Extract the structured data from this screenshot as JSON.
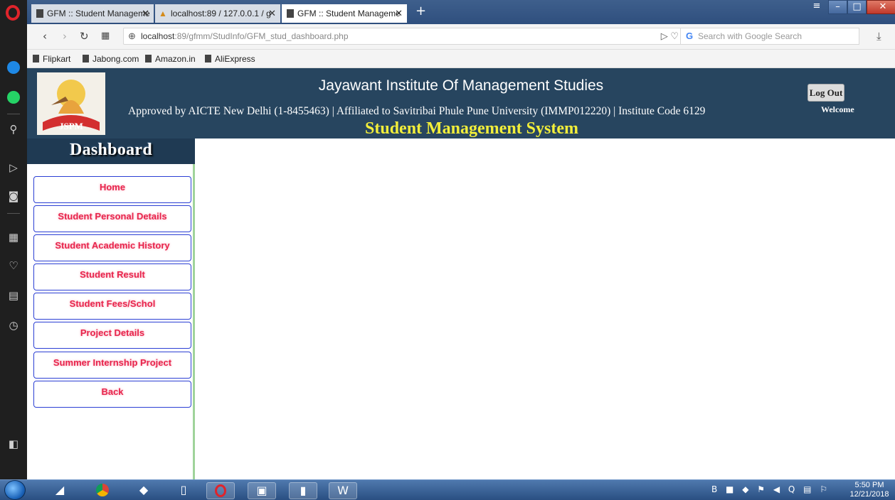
{
  "browser": {
    "tabs": [
      {
        "label": "GFM :: Student Manageme",
        "state": "inactive"
      },
      {
        "label": "localhost:89 / 127.0.0.1 / g",
        "state": "inactive"
      },
      {
        "label": "GFM :: Student Manageme",
        "state": "active"
      }
    ],
    "new_tab_label": "+",
    "url_host": "localhost",
    "url_path": ":89/gfmm/StudInfo/GFM_stud_dashboard.php",
    "search_placeholder": "Search with Google Search",
    "bookmarks": [
      "Flipkart",
      "Jabong.com",
      "Amazon.in",
      "AliExpress"
    ]
  },
  "header": {
    "institute_title": "Jayawant Institute Of Management Studies",
    "subtitle": "Approved by AICTE New Delhi (1-8455463) | Affiliated to Savitribai Phule Pune University (IMMP012220) | Institute Code 6129",
    "welcome": "Welcome",
    "logout_label": "Log Out",
    "system_title": "Student Management System",
    "logo_text": "JSPM"
  },
  "sidebar": {
    "heading": "Dashboard",
    "items": [
      {
        "label": "Home"
      },
      {
        "label": "Student Personal Details"
      },
      {
        "label": "Student Academic History"
      },
      {
        "label": "Student Result"
      },
      {
        "label": "Student Fees/Schol"
      },
      {
        "label": "Project Details"
      },
      {
        "label": "Summer Internship Project"
      },
      {
        "label": "Back"
      }
    ]
  },
  "taskbar": {
    "time": "5:50 PM",
    "date": "12/21/2018"
  },
  "colors": {
    "header_bg": "#27455f",
    "system_title": "#f2ee3a",
    "menu_text": "#e8244c",
    "menu_border": "#2b3fd4"
  }
}
